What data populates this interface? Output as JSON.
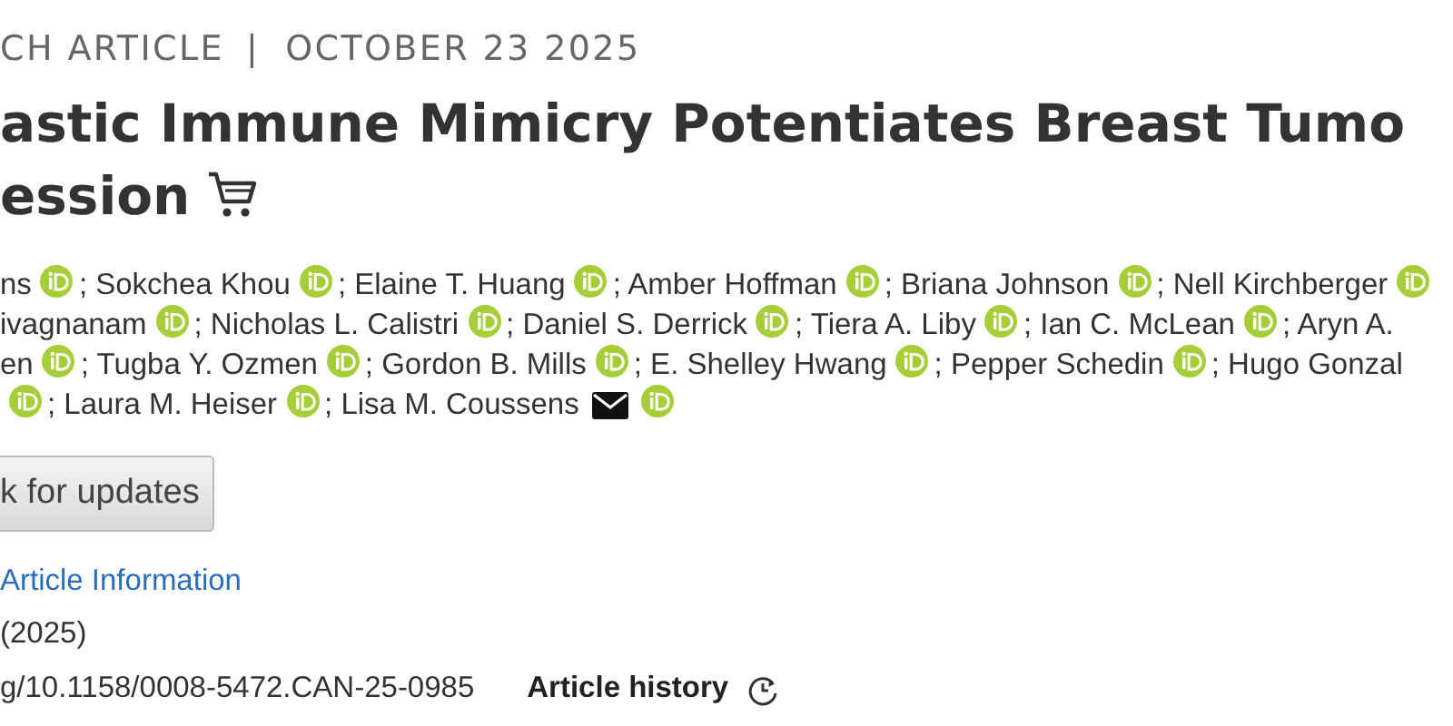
{
  "header": {
    "type": "CH ARTICLE",
    "separator": "|",
    "date": "OCTOBER 23 2025"
  },
  "title": {
    "lines": [
      "astic Immune Mimicry Potentiates Breast Tumo",
      "ession"
    ],
    "cart": true
  },
  "author_lines": [
    [
      {
        "name": "ns",
        "orcid": true,
        "email": false
      },
      {
        "name": "; Sokchea Khou",
        "orcid": true,
        "email": false
      },
      {
        "name": "; Elaine T. Huang",
        "orcid": true,
        "email": false
      },
      {
        "name": "; Amber Hoffman",
        "orcid": true,
        "email": false
      },
      {
        "name": "; Briana Johnson",
        "orcid": true,
        "email": false
      },
      {
        "name": "; Nell Kirchberger",
        "orcid": true,
        "email": false
      }
    ],
    [
      {
        "name": "ivagnanam",
        "orcid": true,
        "email": false
      },
      {
        "name": "; Nicholas L. Calistri",
        "orcid": true,
        "email": false
      },
      {
        "name": "; Daniel S. Derrick",
        "orcid": true,
        "email": false
      },
      {
        "name": "; Tiera A. Liby",
        "orcid": true,
        "email": false
      },
      {
        "name": "; Ian C. McLean",
        "orcid": true,
        "email": false
      },
      {
        "name": "; Aryn A.",
        "orcid": false,
        "email": false
      }
    ],
    [
      {
        "name": "en",
        "orcid": true,
        "email": false
      },
      {
        "name": "; Tugba Y. Ozmen",
        "orcid": true,
        "email": false
      },
      {
        "name": "; Gordon B. Mills",
        "orcid": true,
        "email": false
      },
      {
        "name": "; E. Shelley Hwang",
        "orcid": true,
        "email": false
      },
      {
        "name": "; Pepper Schedin",
        "orcid": true,
        "email": false
      },
      {
        "name": "; Hugo Gonzal",
        "orcid": false,
        "email": false
      }
    ],
    [
      {
        "orcid": true,
        "email": false
      },
      {
        "name": "; Laura M. Heiser",
        "orcid": true,
        "email": false
      },
      {
        "name": "; Lisa M. Coussens",
        "orcid": true,
        "email": true
      }
    ]
  ],
  "updates_button": "k for updates",
  "info_link": "Article Information",
  "year": "(2025)",
  "doi": "g/10.1158/0008-5472.CAN-25-0985",
  "history": {
    "label": "Article history",
    "icon": true
  }
}
